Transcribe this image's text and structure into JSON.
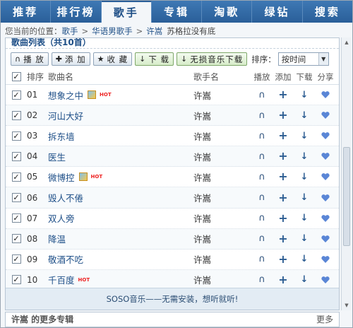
{
  "nav": {
    "items": [
      {
        "label": "推荐",
        "active": false
      },
      {
        "label": "排行榜",
        "active": false
      },
      {
        "label": "歌手",
        "active": true
      },
      {
        "label": "专辑",
        "active": false
      },
      {
        "label": "淘歌",
        "active": false
      },
      {
        "label": "绿钻",
        "active": false
      },
      {
        "label": "搜索",
        "active": false
      }
    ]
  },
  "breadcrumb": {
    "prefix": "您当前的位置：",
    "items": [
      "歌手",
      "华语男歌手",
      "许嵩"
    ],
    "separator": ">",
    "current": "苏格拉没有底"
  },
  "panel": {
    "title": "歌曲列表（共10首）"
  },
  "toolbar": {
    "play_label": "播 放",
    "add_label": "添 加",
    "favorite_label": "收 藏",
    "download_label": "下 载",
    "lossless_label": "无损音乐下载",
    "sort_label": "排序：",
    "sort_value": "按时间"
  },
  "table": {
    "headers": {
      "index": "排序",
      "name": "歌曲名",
      "singer": "歌手名",
      "play": "播放",
      "add": "添加",
      "download": "下载",
      "share": "分享"
    },
    "rows": [
      {
        "index": "01",
        "name": "想象之中",
        "singer": "许嵩",
        "mv": true,
        "hot": "HOT"
      },
      {
        "index": "02",
        "name": "河山大好",
        "singer": "许嵩",
        "mv": false,
        "hot": ""
      },
      {
        "index": "03",
        "name": "拆东墙",
        "singer": "许嵩",
        "mv": false,
        "hot": ""
      },
      {
        "index": "04",
        "name": "医生",
        "singer": "许嵩",
        "mv": false,
        "hot": ""
      },
      {
        "index": "05",
        "name": "微博控",
        "singer": "许嵩",
        "mv": true,
        "hot": "HOT"
      },
      {
        "index": "06",
        "name": "毁人不倦",
        "singer": "许嵩",
        "mv": false,
        "hot": ""
      },
      {
        "index": "07",
        "name": "双人旁",
        "singer": "许嵩",
        "mv": false,
        "hot": ""
      },
      {
        "index": "08",
        "name": "降温",
        "singer": "许嵩",
        "mv": false,
        "hot": ""
      },
      {
        "index": "09",
        "name": "敬酒不吃",
        "singer": "许嵩",
        "mv": false,
        "hot": ""
      },
      {
        "index": "10",
        "name": "千百度",
        "singer": "许嵩",
        "mv": false,
        "hot": "HOT"
      }
    ]
  },
  "footer": {
    "text": "SOSO音乐——无需安装，想听就听!"
  },
  "bottom": {
    "title": "许嵩 的更多专辑",
    "more": "更多"
  },
  "colors": {
    "nav_bg": "#2a5f99",
    "link": "#1e4f88",
    "hot": "#ee2222",
    "share": "#5a86d6"
  },
  "icons": {
    "play": "headphones-icon",
    "add": "plus-icon",
    "download": "arrow-down-icon",
    "share": "heart-icon",
    "mv": "mv-icon"
  }
}
